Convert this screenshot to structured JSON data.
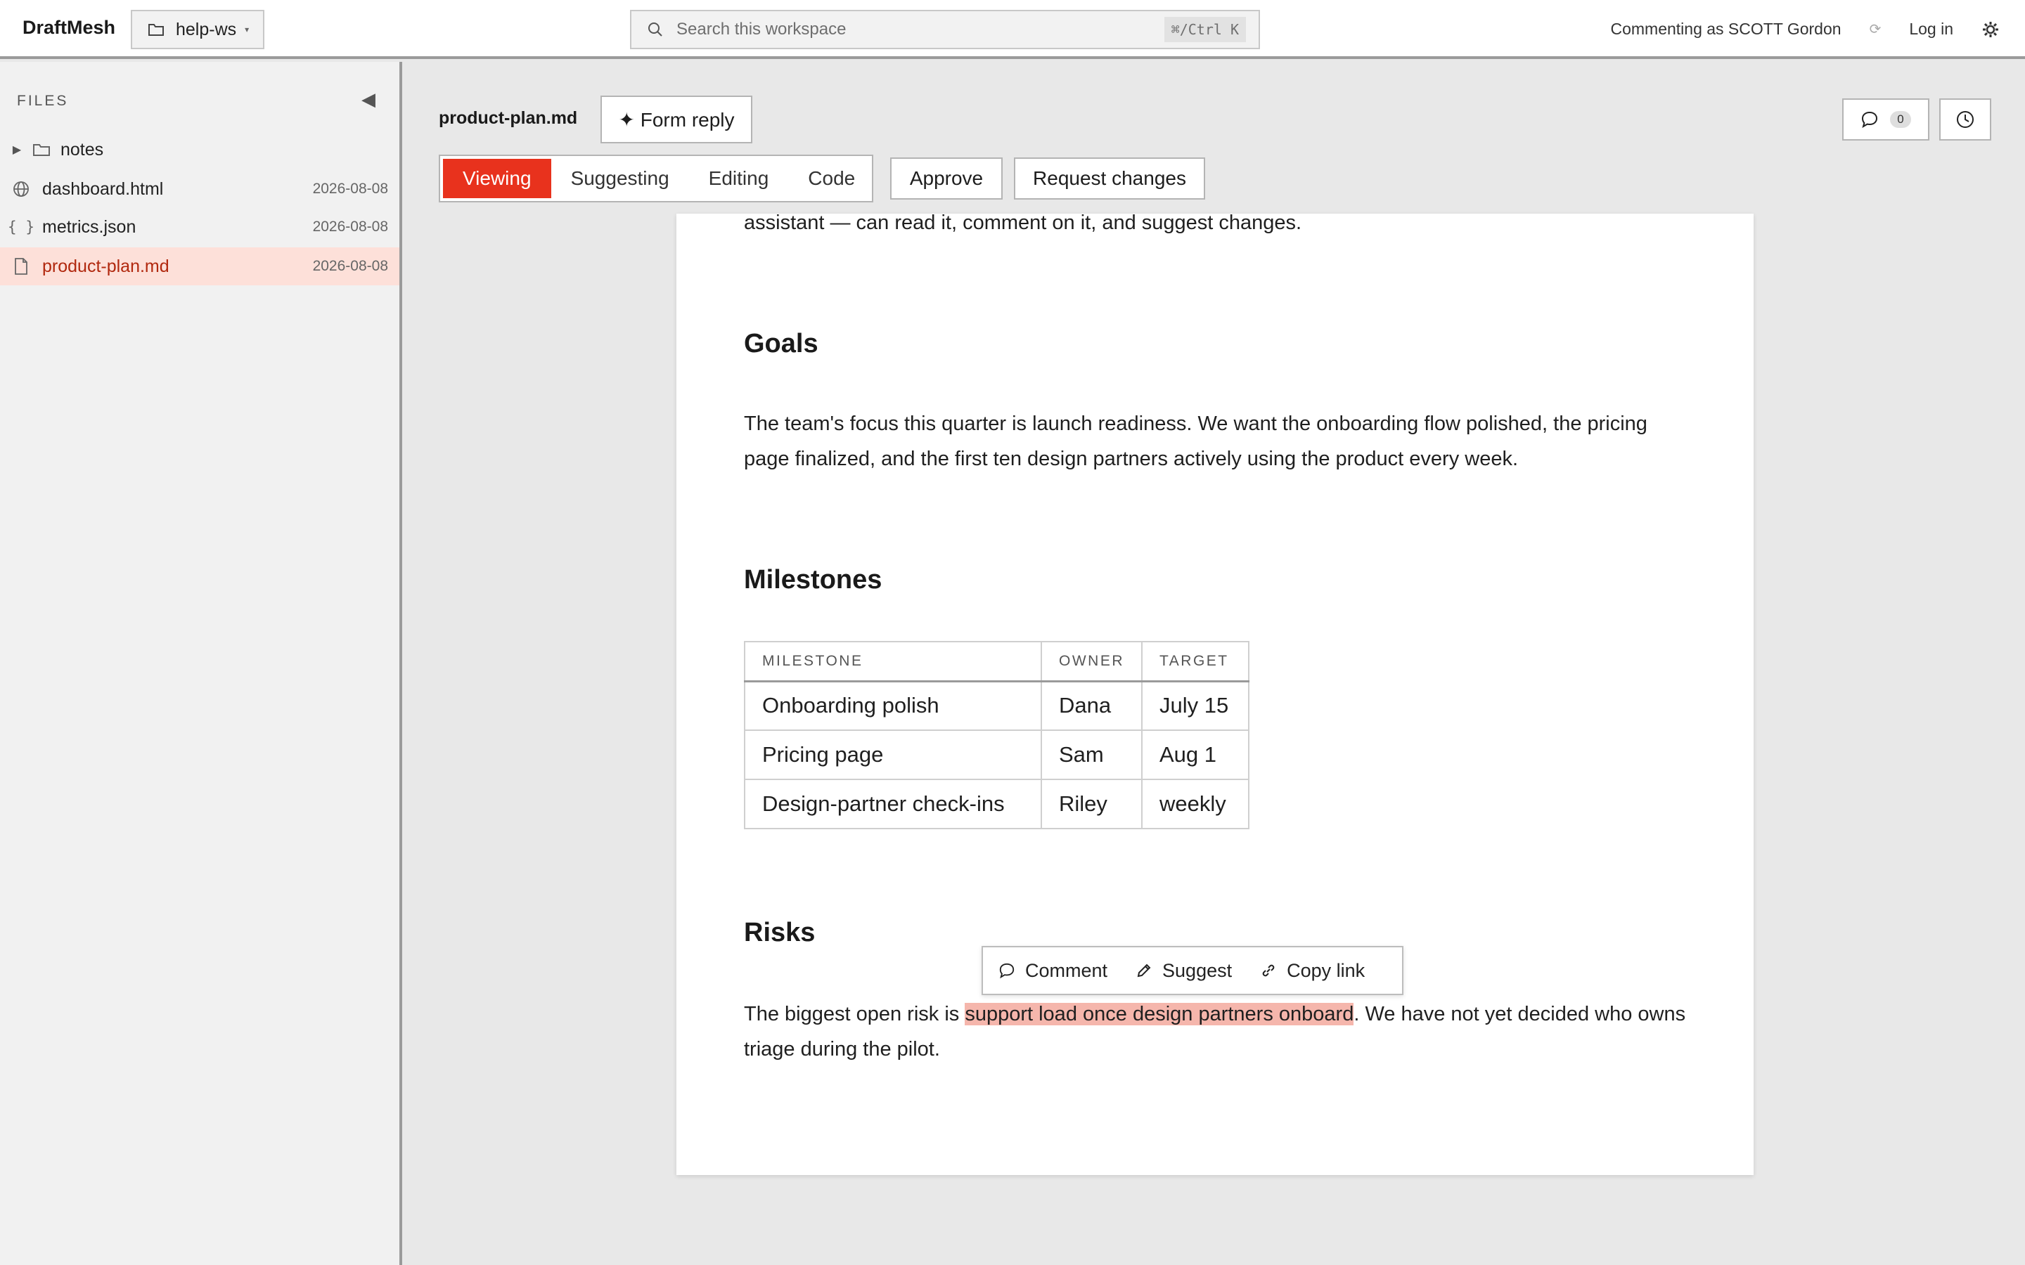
{
  "app": {
    "brand": "DraftMesh",
    "workspace": "help-ws",
    "search_placeholder": "Search this workspace",
    "search_shortcut": "⌘/Ctrl K",
    "commenting_as": "Commenting as SCOTT Gordon",
    "login_label": "Log in"
  },
  "sidebar": {
    "heading": "FILES",
    "folder": "notes",
    "files": [
      {
        "name": "dashboard.html",
        "date": "2026-08-08",
        "icon": "globe-icon"
      },
      {
        "name": "metrics.json",
        "date": "2026-08-08",
        "icon": "braces-icon"
      },
      {
        "name": "product-plan.md",
        "date": "2026-08-08",
        "icon": "file-icon",
        "active": true
      }
    ]
  },
  "toolbar": {
    "filename": "product-plan.md",
    "form_reply": "✦ Form reply",
    "modes": [
      "Viewing",
      "Suggesting",
      "Editing",
      "Code"
    ],
    "active_mode": "Viewing",
    "approve": "Approve",
    "request_changes": "Request changes",
    "comment_count": "0"
  },
  "document": {
    "intro_tail": "assistant — can read it, comment on it, and suggest changes.",
    "goals_heading": "Goals",
    "goals_text": "The team's focus this quarter is launch readiness. We want the onboarding flow polished, the pricing page finalized, and the first ten design partners actively using the product every week.",
    "milestones_heading": "Milestones",
    "table_headers": [
      "MILESTONE",
      "OWNER",
      "TARGET"
    ],
    "table_rows": [
      [
        "Onboarding polish",
        "Dana",
        "July 15"
      ],
      [
        "Pricing page",
        "Sam",
        "Aug 1"
      ],
      [
        "Design-partner check-ins",
        "Riley",
        "weekly"
      ]
    ],
    "risks_heading": "Risks",
    "risks_before": "The biggest open risk is ",
    "risks_highlight": "support load once design partners onboard",
    "risks_after": ". We have not yet decided who owns triage during the pilot."
  },
  "popover": {
    "comment": "Comment",
    "suggest": "Suggest",
    "copy_link": "Copy link"
  },
  "colors": {
    "accent": "#e8321d",
    "highlight": "#f5b6ac",
    "active_file_bg": "#fde0d9"
  }
}
